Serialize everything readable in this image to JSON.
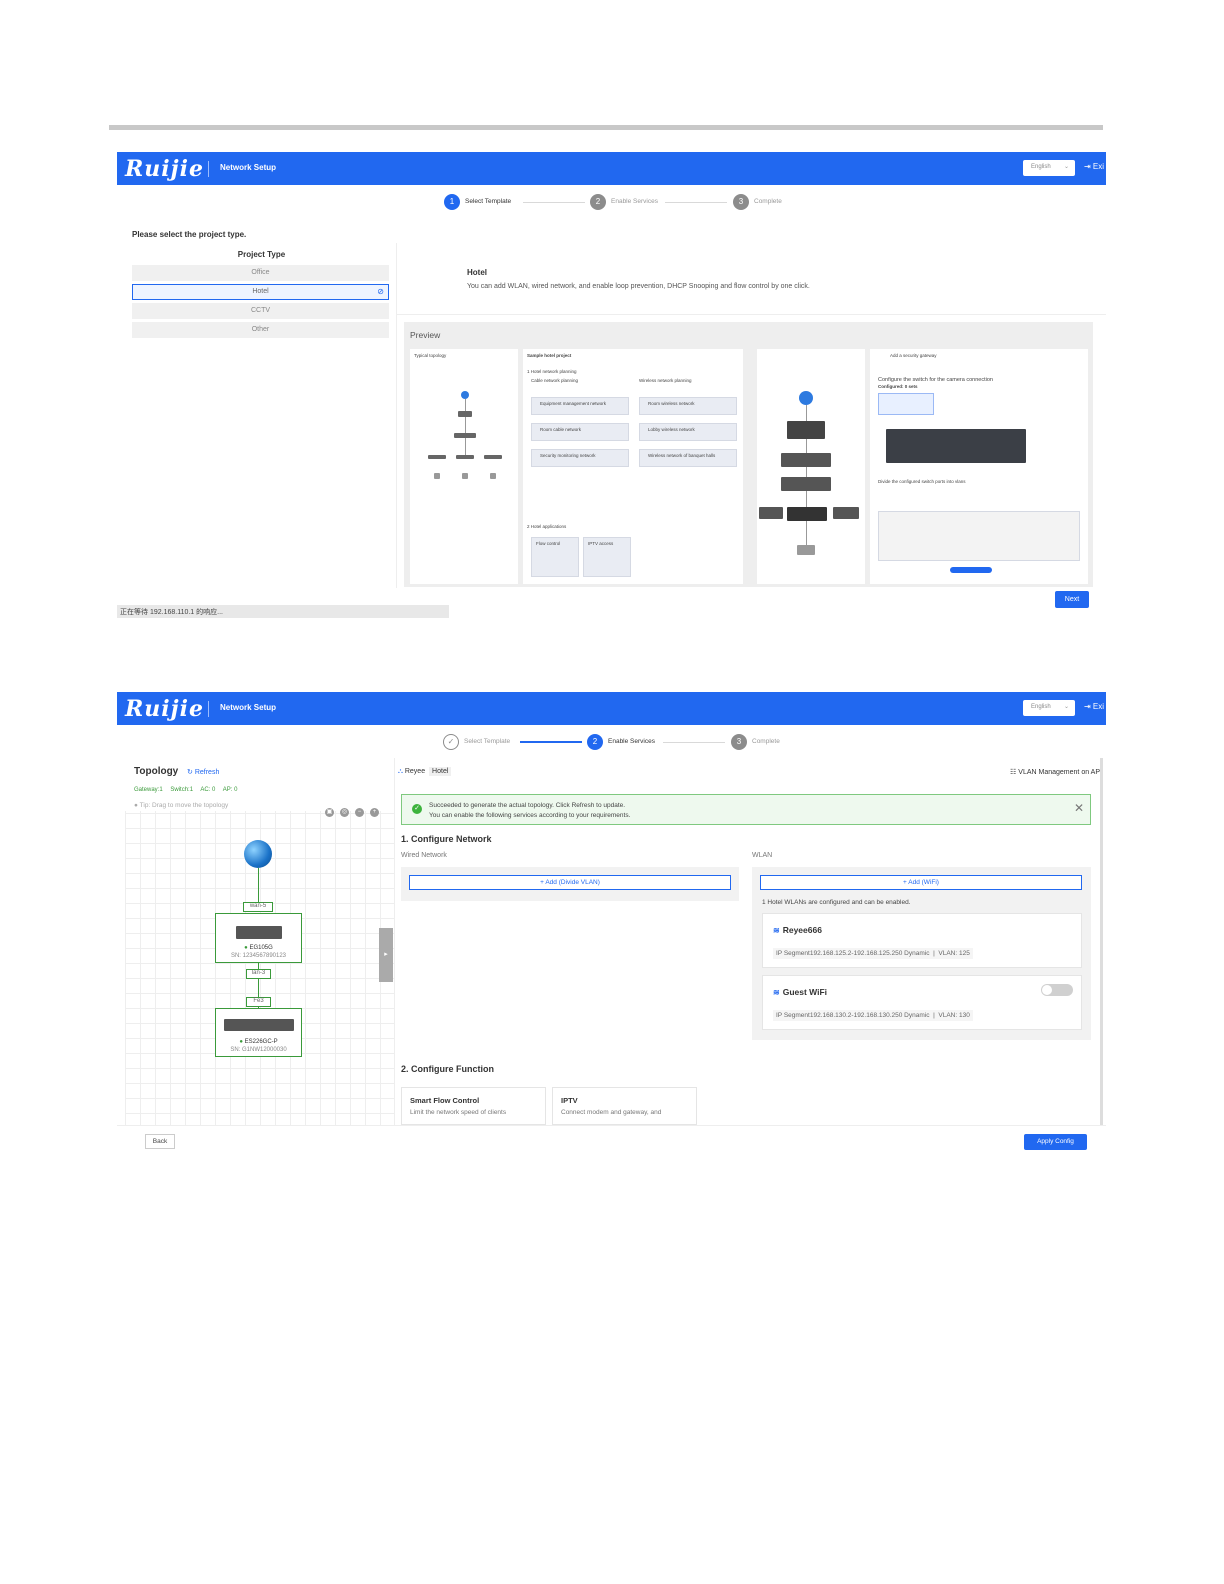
{
  "app": {
    "logo": "Ruijie",
    "title": "Network Setup",
    "language": "English",
    "exit_label": "Exi"
  },
  "steps": [
    {
      "num": "1",
      "label": "Select Template"
    },
    {
      "num": "2",
      "label": "Enable Services"
    },
    {
      "num": "3",
      "label": "Complete"
    }
  ],
  "screen1": {
    "prompt": "Please select the project type.",
    "project_type_header": "Project Type",
    "project_types": [
      "Office",
      "Hotel",
      "CCTV",
      "Other"
    ],
    "selected_type": "Hotel",
    "description_title": "Hotel",
    "description_text": "You can add WLAN, wired network, and enable loop prevention, DHCP Snooping and flow control by one click.",
    "preview_title": "Preview",
    "preview_snippets": {
      "topology": "Typical topology",
      "sample": "Sample hotel project",
      "planning": "1 Hotel network planning",
      "cable": "Cable network planning",
      "wireless": "Wireless network planning",
      "equipment": "Equipment management network",
      "room_wireless": "Room wireless network",
      "room_cable": "Room cable network",
      "lobby": "Lobby wireless network",
      "security": "Security monitoring network",
      "banquet": "Wireless network of banquet halls",
      "apps": "2 Hotel applications",
      "flow": "Flow control",
      "iptv": "IPTV access",
      "gateway": "Add a security gateway",
      "camera": "Configure the switch for the camera connection",
      "configured": "Configured: 0 sets",
      "divide": "Divide the configured switch ports into vlans"
    },
    "next_label": "Next",
    "status_text": "正在等待 192.168.110.1 的响应..."
  },
  "screen2": {
    "topology_title": "Topology",
    "refresh_label": "Refresh",
    "counts": [
      "Gateway:1",
      "Switch:1",
      "AC: 0",
      "AP: 0"
    ],
    "tip": "Tip: Drag to move the topology",
    "nodes": [
      {
        "port_top": "wan-5",
        "name": "EG105G",
        "sn": "SN: 1234567890123",
        "port_bottom": "lan-3"
      },
      {
        "port_top": "Fe3",
        "name": "ES226GC-P",
        "sn": "SN: G1NW12000030"
      }
    ],
    "breadcrumb": [
      "Reyee",
      "Hotel"
    ],
    "vlan_management": "VLAN Management on AP",
    "alert_line1": "Succeeded to generate the actual topology. Click Refresh to update.",
    "alert_line2": "You can enable the following services according to your requirements.",
    "section1": "1. Configure Network",
    "wired_label": "Wired Network",
    "wired_add": "+ Add (Divide VLAN)",
    "wlan_label": "WLAN",
    "wlan_add": "+ Add (WiFi)",
    "wlan_note": "1 Hotel WLANs are configured and can be enabled.",
    "wlans": [
      {
        "ssid": "Reyee666",
        "segment": "IP Segment192.168.125.2-192.168.125.250 Dynamic",
        "vlan": "VLAN: 125"
      },
      {
        "ssid": "Guest WiFi",
        "segment": "IP Segment192.168.130.2-192.168.130.250 Dynamic",
        "vlan": "VLAN: 130"
      }
    ],
    "section2": "2. Configure Function",
    "functions": [
      {
        "title": "Smart Flow Control",
        "desc": "Limit the network speed of clients"
      },
      {
        "title": "IPTV",
        "desc": "Connect modem and gateway, and"
      }
    ],
    "back_label": "Back",
    "apply_label": "Apply Config"
  },
  "colors": {
    "brand_blue": "#2168f0",
    "success_green": "#3db33d"
  }
}
